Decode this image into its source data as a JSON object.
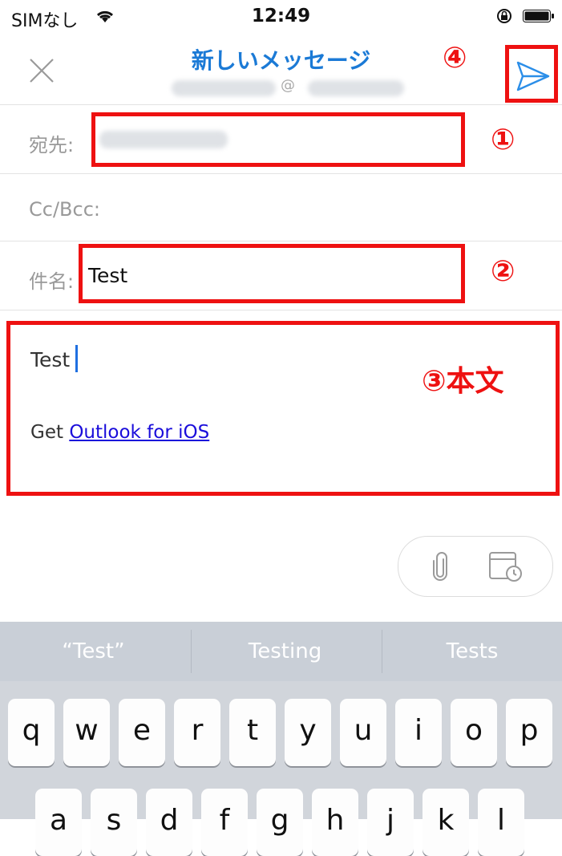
{
  "status_bar": {
    "carrier": "SIMなし",
    "time": "12:49"
  },
  "header": {
    "title": "新しいメッセージ",
    "account_partial": "@"
  },
  "fields": {
    "to_label": "宛先:",
    "cc_label": "Cc/Bcc:",
    "subject_label": "件名:",
    "subject_value": "Test"
  },
  "body": {
    "text": "Test",
    "signature_prefix": "Get",
    "signature_link": "Outlook for iOS"
  },
  "annotations": {
    "to": "①",
    "subject": "②",
    "body": "③本文",
    "send": "④"
  },
  "keyboard": {
    "suggestions": [
      "“Test”",
      "Testing",
      "Tests"
    ],
    "row1": [
      "q",
      "w",
      "e",
      "r",
      "t",
      "y",
      "u",
      "i",
      "o",
      "p"
    ],
    "row2": [
      "a",
      "s",
      "d",
      "f",
      "g",
      "h",
      "j",
      "k",
      "l"
    ]
  },
  "colors": {
    "accent": "#1b7ad6",
    "annotation_red": "#ee1111",
    "link": "#1a0ddb"
  }
}
